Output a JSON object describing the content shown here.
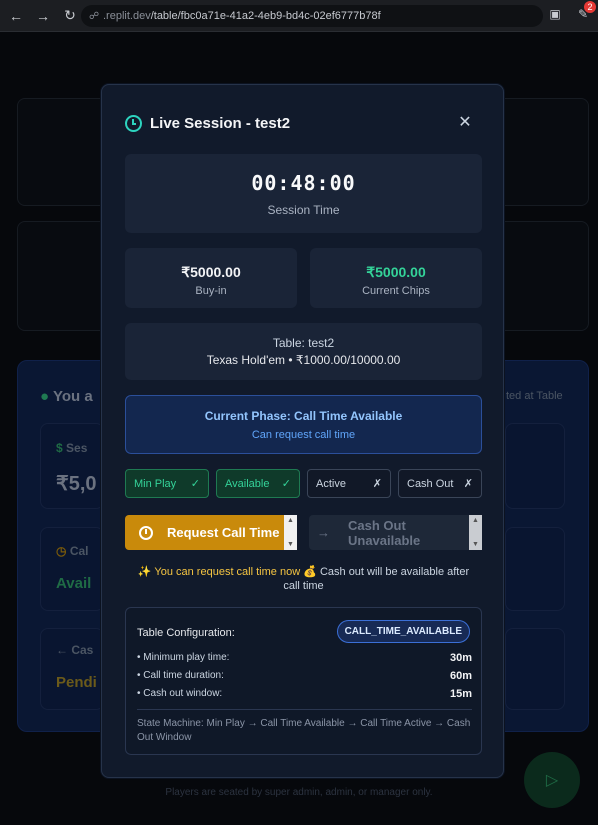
{
  "browser": {
    "url_prefix": ".replit.dev",
    "url_path": "/table/fbc0a71e-41a2-4eb9-bd4c-02ef6777b78f",
    "notification_count": "2"
  },
  "background": {
    "you_label": "You a",
    "seated_text": "ted at Table",
    "session_label": "Ses",
    "amount": "₹5,0",
    "call_label": "Cal",
    "avail_label": "Avail",
    "cash_label": "Cas",
    "pending_label": "Pendi",
    "footer": "Players are seated by super admin, admin, or manager only."
  },
  "modal": {
    "title": "Live Session - test2",
    "timer": {
      "value": "00:48:00",
      "label": "Session Time"
    },
    "buy_in": {
      "value": "₹5000.00",
      "label": "Buy-in"
    },
    "current_chips": {
      "value": "₹5000.00",
      "label": "Current Chips"
    },
    "table_info": {
      "line1": "Table: test2",
      "line2": "Texas Hold'em • ₹1000.00/10000.00"
    },
    "phase": {
      "title": "Current Phase: Call Time Available",
      "subtitle": "Can request call time"
    },
    "chips": [
      {
        "label": "Min Play",
        "mark": "✓",
        "state": "on"
      },
      {
        "label": "Available",
        "mark": "✓",
        "state": "on"
      },
      {
        "label": "Active",
        "mark": "✗",
        "state": "off"
      },
      {
        "label": "Cash Out",
        "mark": "✗",
        "state": "off"
      }
    ],
    "request_call_button": "Request Call Time",
    "cash_out_button": "Cash Out Unavailable",
    "hint_highlight": "✨ You can request call time now",
    "hint_rest": "💰 Cash out will be available after call time",
    "config": {
      "title": "Table Configuration:",
      "badge": "CALL_TIME_AVAILABLE",
      "rows": [
        {
          "label": "• Minimum play time:",
          "value": "30m"
        },
        {
          "label": "• Call time duration:",
          "value": "60m"
        },
        {
          "label": "• Cash out window:",
          "value": "15m"
        }
      ],
      "state_machine": "State Machine: Min Play → Call Time Available → Call Time Active → Cash Out Window"
    }
  }
}
